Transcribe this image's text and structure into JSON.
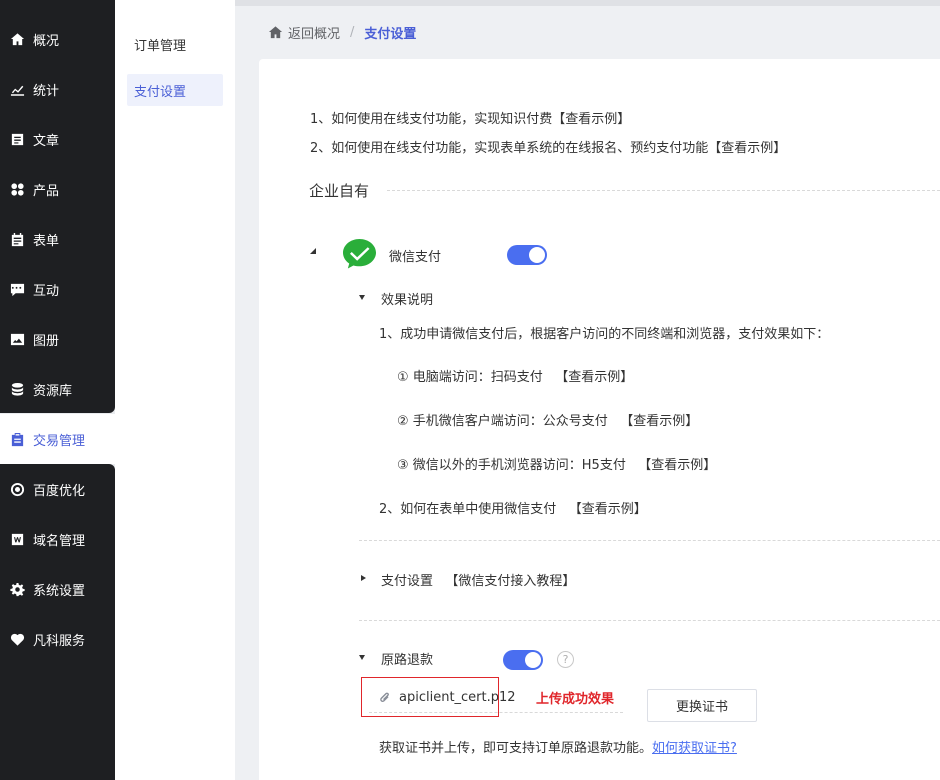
{
  "sidebar": {
    "items": [
      {
        "label": "概况",
        "icon": "home-icon"
      },
      {
        "label": "统计",
        "icon": "stats-icon"
      },
      {
        "label": "文章",
        "icon": "article-icon"
      },
      {
        "label": "产品",
        "icon": "product-icon"
      },
      {
        "label": "表单",
        "icon": "form-icon"
      },
      {
        "label": "互动",
        "icon": "chat-icon"
      },
      {
        "label": "图册",
        "icon": "album-icon"
      },
      {
        "label": "资源库",
        "icon": "database-icon"
      },
      {
        "label": "交易管理",
        "icon": "clipboard-icon"
      },
      {
        "label": "百度优化",
        "icon": "seo-icon"
      },
      {
        "label": "域名管理",
        "icon": "domain-icon"
      },
      {
        "label": "系统设置",
        "icon": "gear-icon"
      },
      {
        "label": "凡科服务",
        "icon": "heart-icon"
      }
    ],
    "active_index": 8
  },
  "submenu": {
    "items": [
      "订单管理",
      "支付设置"
    ],
    "active_index": 1
  },
  "breadcrumb": {
    "back": "返回概况",
    "separator": "/",
    "current": "支付设置"
  },
  "intro": {
    "line1_text": "1、如何使用在线支付功能，实现知识付费",
    "line1_link": "【查看示例】",
    "line2_text": "2、如何使用在线支付功能，实现表单系统的在线报名、预约支付功能",
    "line2_link": "【查看示例】"
  },
  "section_title": "企业自有",
  "wechat": {
    "label": "微信支付",
    "enabled": true,
    "effect_title": "效果说明",
    "effect_line1": "1、成功申请微信支付后，根据客户访问的不同终端和浏览器，支付效果如下：",
    "pc_text": "① 电脑端访问：扫码支付",
    "pc_link": "【查看示例】",
    "mobile_wx_text": "② 手机微信客户端访问：公众号支付",
    "mobile_wx_link": "【查看示例】",
    "mobile_other_text": "③ 微信以外的手机浏览器访问：H5支付",
    "mobile_other_link": "【查看示例】",
    "form_text": "2、如何在表单中使用微信支付",
    "form_link": "【查看示例】",
    "pay_settings_title": "支付设置",
    "pay_settings_link": "【微信支付接入教程】",
    "refund_title": "原路退款",
    "refund_enabled": true,
    "help": "?",
    "file_name": "apiclient_cert.p12",
    "upload_tip": "上传成功效果",
    "replace_button": "更换证书",
    "hint_text": "获取证书并上传，即可支持订单原路退款功能。",
    "hint_link": "如何获取证书?"
  },
  "colors": {
    "accent": "#4a5fd6",
    "toggle": "#4a6ef0",
    "sidebar_bg": "#1e1f22",
    "wechat_green": "#2aae3a",
    "tip_red": "#e0262b"
  }
}
